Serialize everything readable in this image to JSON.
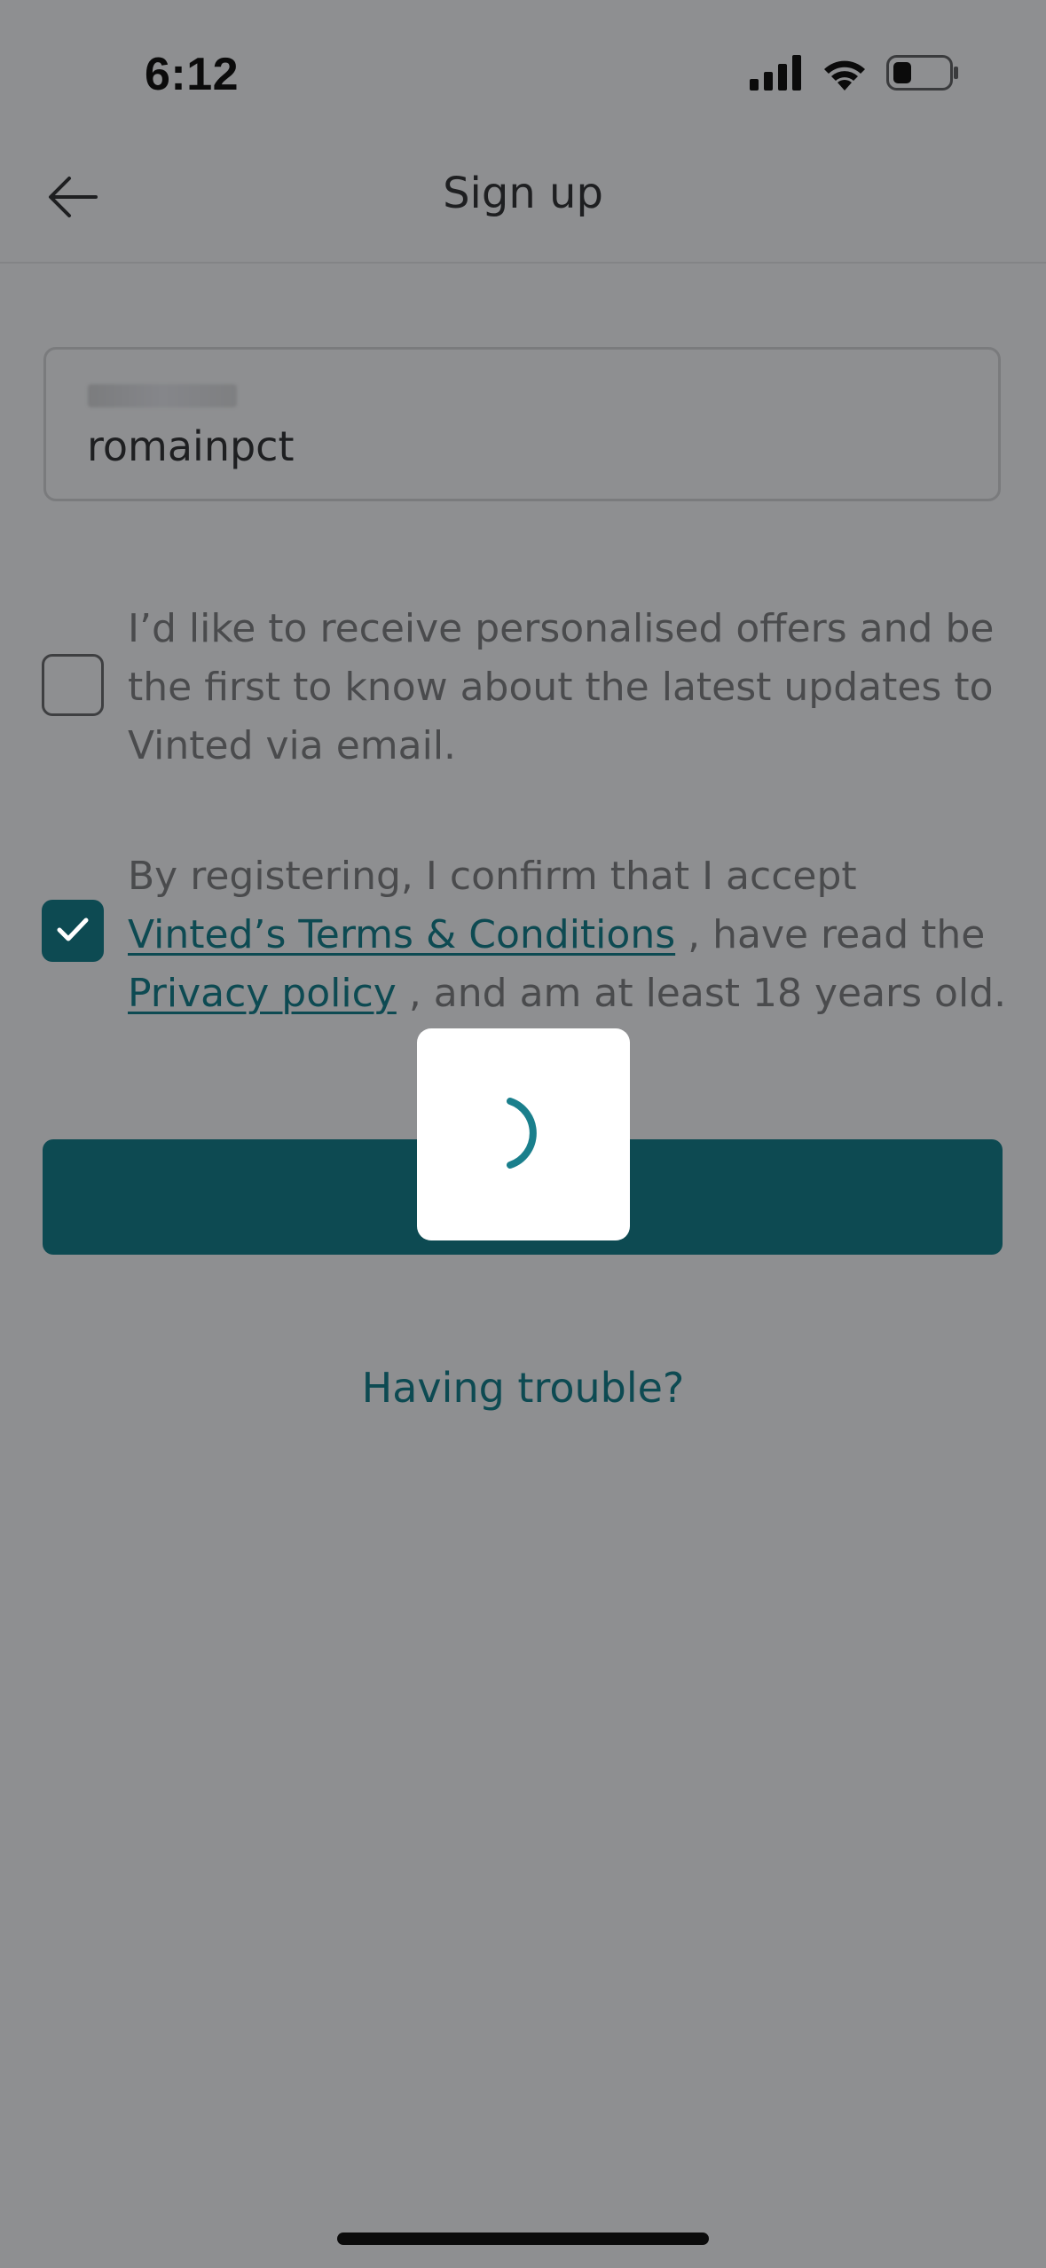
{
  "status_bar": {
    "time": "6:12",
    "icons": [
      "cellular-signal-icon",
      "wifi-icon",
      "battery-icon"
    ]
  },
  "header": {
    "title": "Sign up",
    "back_icon": "arrow-left-icon"
  },
  "form": {
    "username_value": "romainpct",
    "offers_text": "I’d like to receive personalised offers and be the first to know about the latest updates to Vinted via email.",
    "offers_checked": false,
    "terms_prefix": "By registering, I confirm that I accept ",
    "terms_link": "Vinted’s Terms & Conditions",
    "terms_middle": ", have read the ",
    "privacy_link": "Privacy policy",
    "terms_suffix": ", and am at least 18 years old.",
    "terms_checked": true
  },
  "trouble_link": "Having trouble?",
  "loader": {
    "state": "loading",
    "icon": "spinner-icon"
  },
  "colors": {
    "accent": "#0d4a52",
    "overlay_background": "#8e8f91",
    "spinner": "#1a7f8c"
  }
}
